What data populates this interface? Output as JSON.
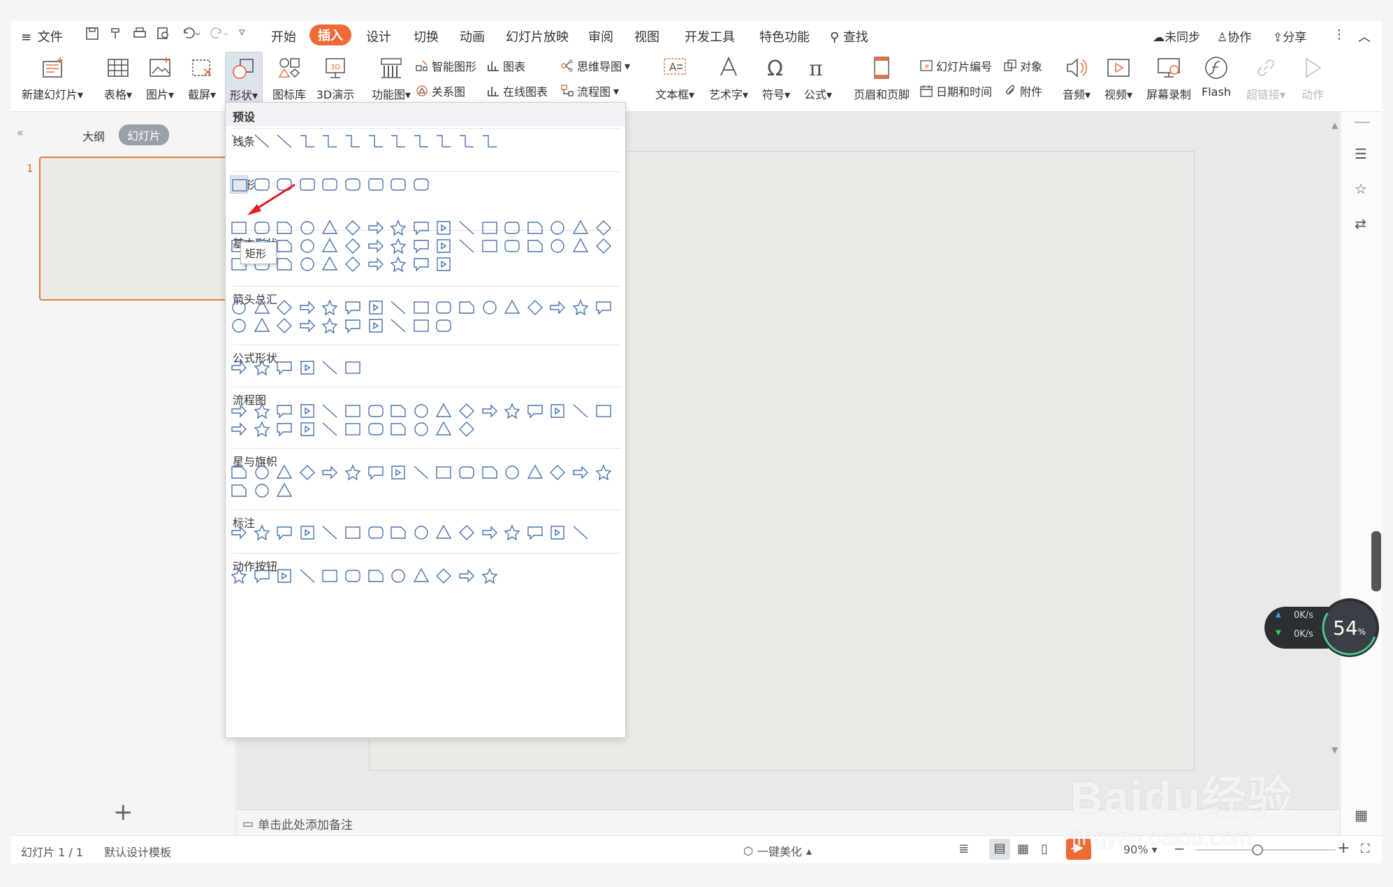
{
  "menubar": {
    "file": "文件",
    "tabs": [
      "开始",
      "插入",
      "设计",
      "切换",
      "动画",
      "幻灯片放映",
      "审阅",
      "视图",
      "开发工具",
      "特色功能"
    ],
    "active_tab": "插入",
    "search": "查找",
    "right": [
      "未同步",
      "协作",
      "分享"
    ]
  },
  "ribbon": {
    "new_slide": "新建幻灯片",
    "table": "表格",
    "picture": "图片",
    "screenshot": "截屏",
    "shape": "形状",
    "icon_lib": "图标库",
    "demo3d": "3D演示",
    "function_chart": "功能图",
    "smart_graphic": "智能图形",
    "chart": "图表",
    "mindmap": "思维导图",
    "relation": "关系图",
    "online_chart": "在线图表",
    "flowchart": "流程图",
    "textbox": "文本框",
    "wordart": "艺术字",
    "symbol": "符号",
    "formula": "公式",
    "header_footer": "页眉和页脚",
    "slide_number": "幻灯片编号",
    "object": "对象",
    "datetime": "日期和时间",
    "attachment": "附件",
    "audio": "音频",
    "video": "视频",
    "screen_record": "屏幕录制",
    "flash": "Flash",
    "hyperlink": "超链接",
    "action": "动作"
  },
  "leftpanel": {
    "outline_tab": "大纲",
    "slides_tab": "幻灯片",
    "slide_number": "1",
    "add": "+"
  },
  "shapes_menu": {
    "header": "预设",
    "sections": [
      "线条",
      "矩形",
      "基本形状",
      "箭头总汇",
      "公式形状",
      "流程图",
      "星与旗帜",
      "标注",
      "动作按钮"
    ],
    "tooltip": "矩形"
  },
  "notes_placeholder": "单击此处添加备注",
  "status": {
    "slide_info": "幻灯片 1 / 1",
    "template": "默认设计模板",
    "beautify": "一键美化",
    "zoom": "90%"
  },
  "net_widget": {
    "up": "0K/s",
    "down": "0K/s",
    "percent": "54",
    "unit": "%"
  },
  "watermark": {
    "logo": "Baidu经验",
    "url": "jingyan.baidu.com"
  },
  "colors": {
    "accent": "#f06a35",
    "shape_stroke": "#4a72b0",
    "arrow": "#e02020"
  }
}
